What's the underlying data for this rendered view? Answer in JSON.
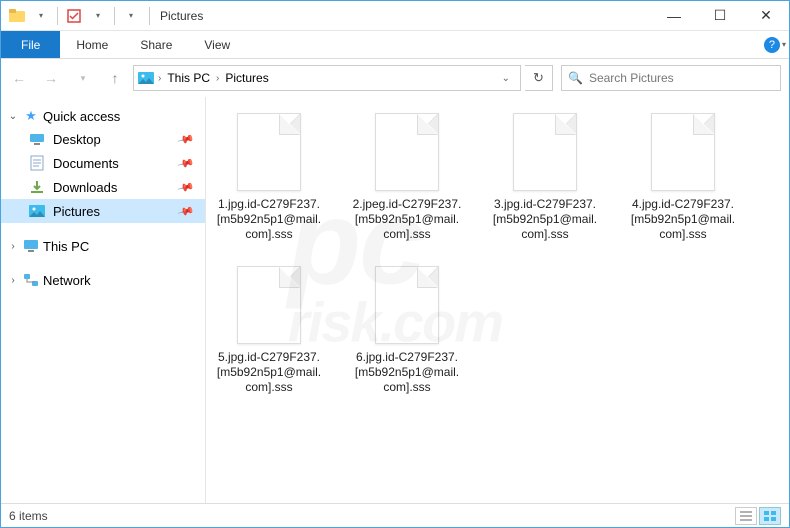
{
  "window": {
    "title": "Pictures"
  },
  "ribbon": {
    "file": "File",
    "tabs": [
      "Home",
      "Share",
      "View"
    ]
  },
  "address": {
    "crumbs": [
      "This PC",
      "Pictures"
    ]
  },
  "search": {
    "placeholder": "Search Pictures"
  },
  "sidebar": {
    "quick_access": {
      "label": "Quick access",
      "items": [
        {
          "label": "Desktop",
          "icon": "monitor",
          "pinned": true
        },
        {
          "label": "Documents",
          "icon": "doc",
          "pinned": true
        },
        {
          "label": "Downloads",
          "icon": "dl",
          "pinned": true
        },
        {
          "label": "Pictures",
          "icon": "pic",
          "pinned": true,
          "selected": true
        }
      ]
    },
    "this_pc": {
      "label": "This PC"
    },
    "network": {
      "label": "Network"
    }
  },
  "files": [
    {
      "name": "1.jpg.id-C279F237.[m5b92n5p1@mail.com].sss"
    },
    {
      "name": "2.jpeg.id-C279F237.[m5b92n5p1@mail.com].sss"
    },
    {
      "name": "3.jpg.id-C279F237.[m5b92n5p1@mail.com].sss"
    },
    {
      "name": "4.jpg.id-C279F237.[m5b92n5p1@mail.com].sss"
    },
    {
      "name": "5.jpg.id-C279F237.[m5b92n5p1@mail.com].sss"
    },
    {
      "name": "6.jpg.id-C279F237.[m5b92n5p1@mail.com].sss"
    }
  ],
  "status": {
    "count": "6 items"
  }
}
